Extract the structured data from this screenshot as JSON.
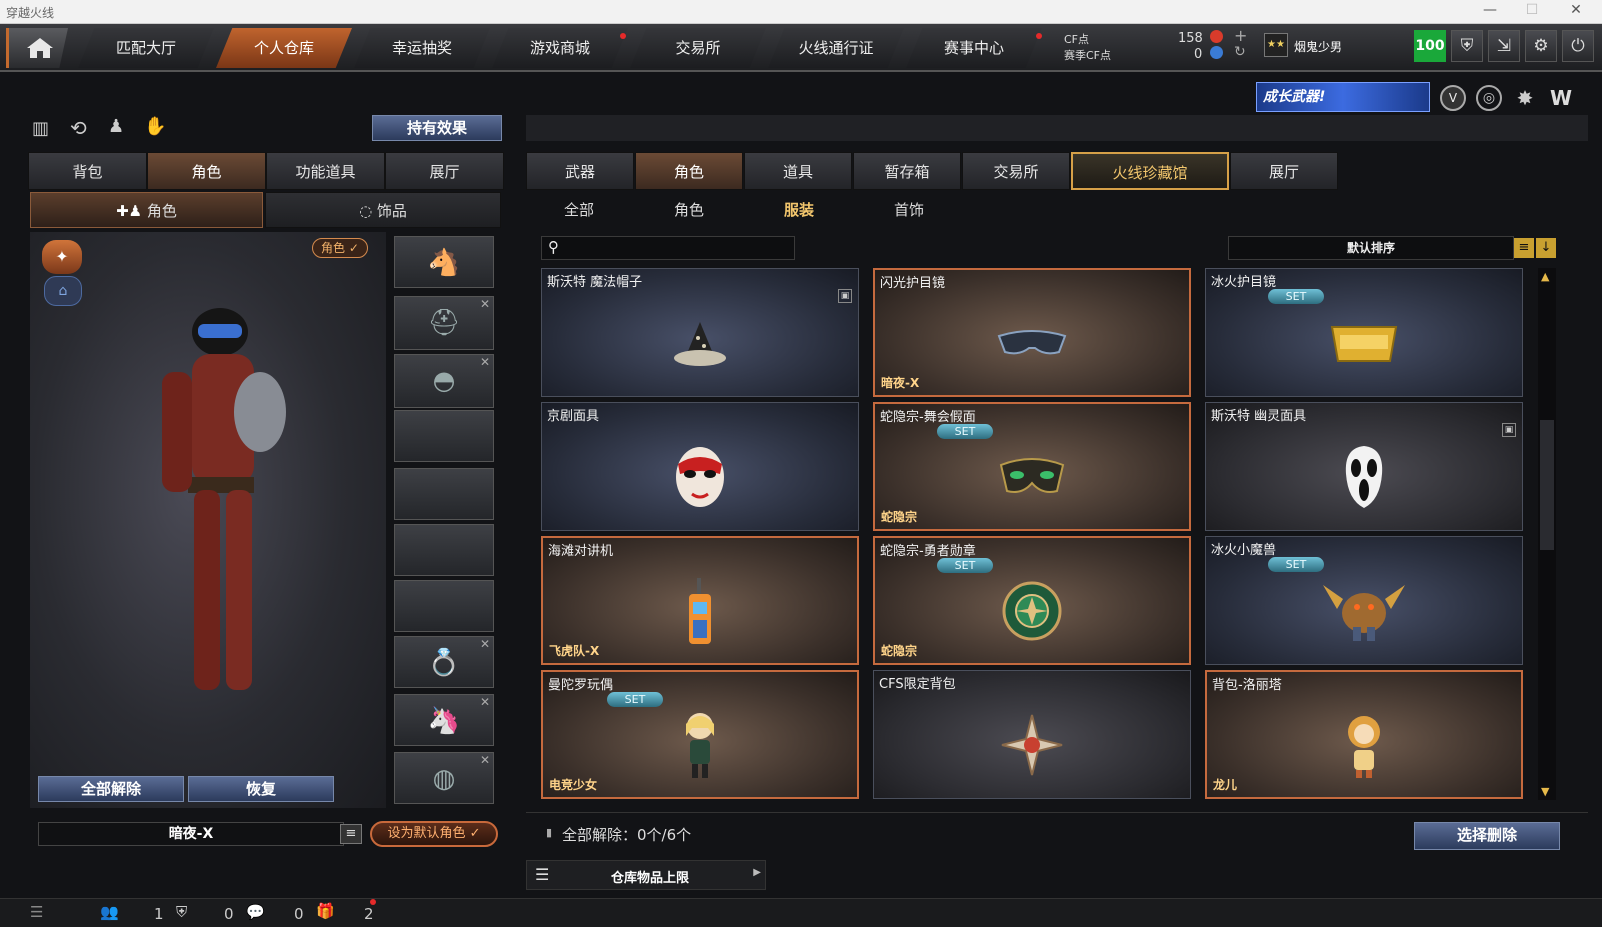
{
  "window": {
    "title": "穿越火线"
  },
  "nav": {
    "tabs": [
      "匹配大厅",
      "个人仓库",
      "幸运抽奖",
      "游戏商城",
      "交易所",
      "火线通行证",
      "赛事中心"
    ],
    "active_index": 1,
    "cf_label": "CF点",
    "season_cf_label": "赛季CF点",
    "cf_value": "158",
    "season_cf_value": "0",
    "username": "烟鬼少男",
    "level": "100"
  },
  "banner": {
    "text": "成长武器!"
  },
  "left": {
    "effect_btn": "持有效果",
    "tabs": [
      "背包",
      "角色",
      "功能道具",
      "展厅"
    ],
    "active_tab": 1,
    "subtabs": [
      "角色",
      "饰品"
    ],
    "role_badge": "角色",
    "unequip_all": "全部解除",
    "restore": "恢复",
    "current_role": "暗夜-X",
    "set_default": "设为默认角色"
  },
  "right": {
    "tabs": [
      "武器",
      "角色",
      "道具",
      "暂存箱",
      "交易所",
      "火线珍藏馆",
      "展厅"
    ],
    "active_tab": 1,
    "gold_tab": 5,
    "subtabs": [
      "全部",
      "角色",
      "服装",
      "首饰"
    ],
    "active_sub": 2,
    "search_placeholder": "",
    "sort_label": "默认排序",
    "items": [
      {
        "name": "斯沃特 魔法帽子",
        "style": "normal",
        "set": false,
        "tag": "",
        "lock": true,
        "art": "hat-icon"
      },
      {
        "name": "闪光护目镜",
        "style": "brown",
        "set": false,
        "tag": "暗夜-X",
        "lock": false,
        "art": "goggles-icon"
      },
      {
        "name": "冰火护目镜",
        "style": "normal",
        "set": true,
        "tag": "",
        "lock": false,
        "art": "gold-visor-icon"
      },
      {
        "name": "京剧面具",
        "style": "normal",
        "set": false,
        "tag": "",
        "lock": false,
        "art": "opera-mask-icon"
      },
      {
        "name": "蛇隐宗-舞会假面",
        "style": "brown",
        "set": true,
        "tag": "蛇隐宗",
        "lock": false,
        "art": "masquerade-mask-icon"
      },
      {
        "name": "斯沃特 幽灵面具",
        "style": "dark",
        "set": false,
        "tag": "",
        "lock": true,
        "art": "ghost-mask-icon"
      },
      {
        "name": "海滩对讲机",
        "style": "brown",
        "set": false,
        "tag": "飞虎队-X",
        "lock": false,
        "art": "walkie-talkie-icon"
      },
      {
        "name": "蛇隐宗-勇者勋章",
        "style": "brown",
        "set": true,
        "tag": "蛇隐宗",
        "lock": false,
        "art": "medal-icon"
      },
      {
        "name": "冰火小魔兽",
        "style": "normal",
        "set": true,
        "tag": "",
        "lock": false,
        "art": "beast-icon"
      },
      {
        "name": "曼陀罗玩偶",
        "style": "brown",
        "set": true,
        "tag": "电竞少女",
        "lock": false,
        "art": "doll-icon"
      },
      {
        "name": "CFS限定背包",
        "style": "dark",
        "set": false,
        "tag": "",
        "lock": false,
        "art": "star-badge-icon"
      },
      {
        "name": "背包-洛丽塔",
        "style": "brown",
        "set": false,
        "tag": "龙儿",
        "lock": false,
        "art": "lolita-doll-icon"
      }
    ],
    "set_label": "SET",
    "footer_text": "全部解除：0个/6个",
    "delete_btn": "选择删除",
    "capacity_label": "仓库物品上限"
  },
  "bottom": {
    "count1": "1",
    "count2": "0",
    "count3": "0",
    "count4": "2"
  },
  "colors": {
    "accent_orange": "#c46a2e",
    "gold": "#d6a048",
    "set_cyan": "#6fc0d6",
    "level_green": "#1aa83a"
  }
}
